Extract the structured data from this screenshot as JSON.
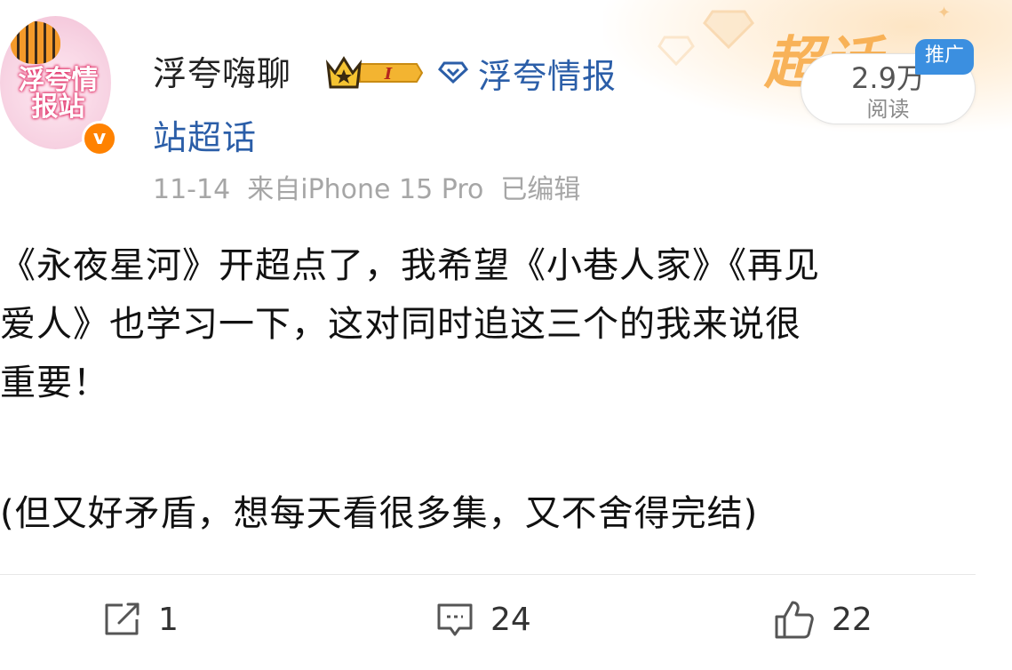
{
  "header": {
    "avatar_text": "浮夸情报站",
    "username": "浮夸嗨聊",
    "badge_level": "I",
    "topic_line1": "浮夸情报",
    "topic_line2": "站超话",
    "chaohua_logo": "超话",
    "meta": "11-14  来自iPhone 15 Pro  已编辑",
    "reads_count": "2.9万",
    "reads_label": "阅读",
    "promo_tag": "推广"
  },
  "post": {
    "text": "《永夜星河》开超点了，我希望《小巷人家》《再见\n爱人》也学习一下，这对同时追这三个的我来说很\n重要！",
    "text2": "(但又好矛盾，想每天看很多集，又不舍得完结)"
  },
  "actions": {
    "repost_count": "1",
    "comment_count": "24",
    "like_count": "22"
  },
  "colors": {
    "topic_link": "#2b5ea8",
    "verified": "#ff8200",
    "promo": "#3b8fe0"
  }
}
